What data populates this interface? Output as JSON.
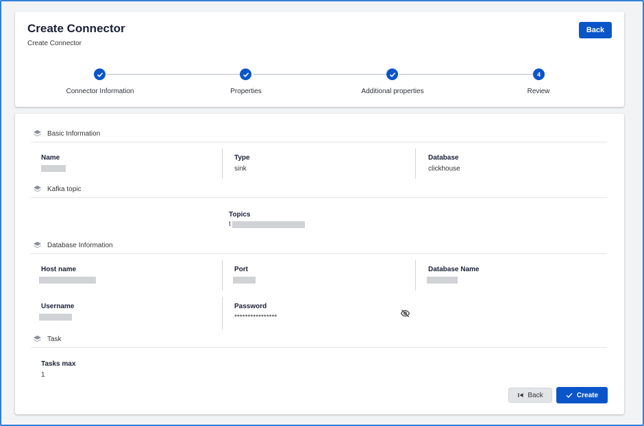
{
  "header": {
    "title": "Create Connector",
    "subtitle": "Create Connector",
    "back_label": "Back"
  },
  "stepper": {
    "steps": [
      {
        "label": "Connector Information",
        "status": "complete",
        "marker": "✓"
      },
      {
        "label": "Properties",
        "status": "complete",
        "marker": "✓"
      },
      {
        "label": "Additional properties",
        "status": "complete",
        "marker": "✓"
      },
      {
        "label": "Review",
        "status": "current",
        "marker": "4"
      }
    ]
  },
  "sections": {
    "basic": {
      "title": "Basic Information",
      "name_label": "Name",
      "name_value": "",
      "type_label": "Type",
      "type_value": "sink",
      "database_label": "Database",
      "database_value": "clickhouse"
    },
    "kafka": {
      "title": "Kafka topic",
      "topics_label": "Topics",
      "topics_value": "t"
    },
    "database": {
      "title": "Database Information",
      "host_label": "Host name",
      "host_value": "",
      "port_label": "Port",
      "port_value": "",
      "dbname_label": "Database Name",
      "dbname_value": "",
      "username_label": "Username",
      "username_value": "",
      "password_label": "Password",
      "password_value": "****************",
      "password_toggle_icon": "eye-off-icon"
    },
    "task": {
      "title": "Task",
      "tasks_max_label": "Tasks max",
      "tasks_max_value": "1"
    }
  },
  "footer": {
    "back_label": "Back",
    "create_label": "Create"
  },
  "colors": {
    "primary": "#0a55c8",
    "frame_border": "#2f7fd8",
    "secondary_button": "#e2e4e7"
  }
}
